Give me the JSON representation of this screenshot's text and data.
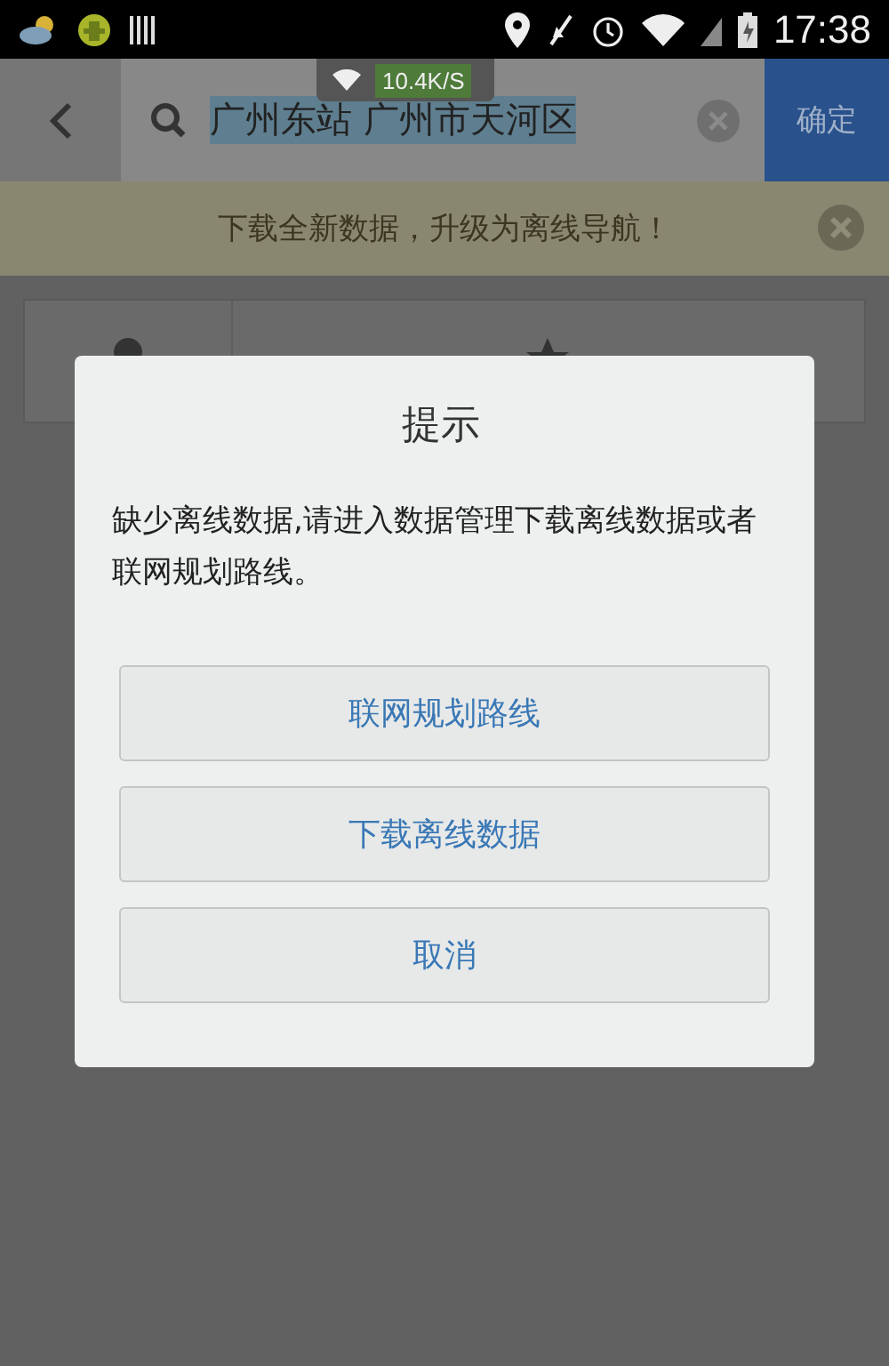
{
  "status_bar": {
    "time": "17:38",
    "net_speed": "10.4K/S"
  },
  "search_bar": {
    "value": "广州东站 广州市天河区",
    "selected": true,
    "confirm": "确定"
  },
  "banner": {
    "text": "下载全新数据，升级为离线导航！"
  },
  "dialog": {
    "title": "提示",
    "message": "缺少离线数据,请进入数据管理下载离线数据或者联网规划路线。",
    "buttons": [
      "联网规划路线",
      "下载离线数据",
      "取消"
    ]
  }
}
